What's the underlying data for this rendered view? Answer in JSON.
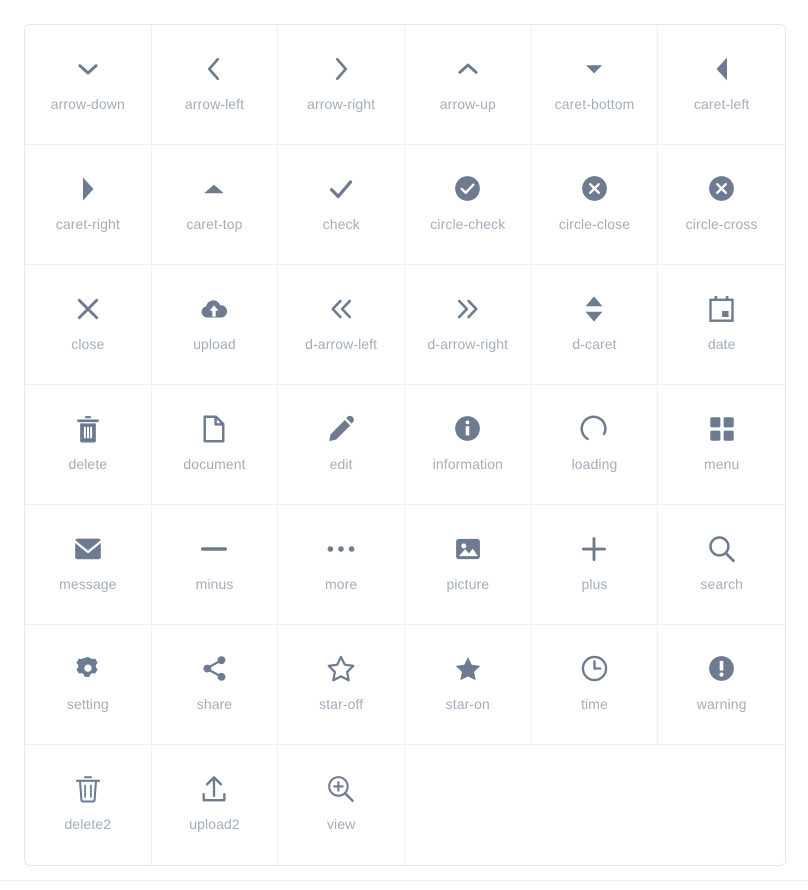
{
  "gallery": {
    "columns": 6,
    "icon_color": "#6c7b8f",
    "label_color": "#a3adbe",
    "grid_line_color": "#eef0f5",
    "border_color": "#e4e7f0",
    "background": "#ffffff",
    "icons": [
      {
        "name": "arrow-down",
        "label": "arrow-down",
        "glyph": "arrow-down-icon"
      },
      {
        "name": "arrow-left",
        "label": "arrow-left",
        "glyph": "arrow-left-icon"
      },
      {
        "name": "arrow-right",
        "label": "arrow-right",
        "glyph": "arrow-right-icon"
      },
      {
        "name": "arrow-up",
        "label": "arrow-up",
        "glyph": "arrow-up-icon"
      },
      {
        "name": "caret-bottom",
        "label": "caret-bottom",
        "glyph": "caret-bottom-icon"
      },
      {
        "name": "caret-left",
        "label": "caret-left",
        "glyph": "caret-left-icon"
      },
      {
        "name": "caret-right",
        "label": "caret-right",
        "glyph": "caret-right-icon"
      },
      {
        "name": "caret-top",
        "label": "caret-top",
        "glyph": "caret-top-icon"
      },
      {
        "name": "check",
        "label": "check",
        "glyph": "check-icon"
      },
      {
        "name": "circle-check",
        "label": "circle-check",
        "glyph": "circle-check-icon"
      },
      {
        "name": "circle-close",
        "label": "circle-close",
        "glyph": "circle-close-icon"
      },
      {
        "name": "circle-cross",
        "label": "circle-cross",
        "glyph": "circle-cross-icon"
      },
      {
        "name": "close",
        "label": "close",
        "glyph": "close-icon"
      },
      {
        "name": "upload",
        "label": "upload",
        "glyph": "cloud-upload-icon"
      },
      {
        "name": "d-arrow-left",
        "label": "d-arrow-left",
        "glyph": "double-arrow-left-icon"
      },
      {
        "name": "d-arrow-right",
        "label": "d-arrow-right",
        "glyph": "double-arrow-right-icon"
      },
      {
        "name": "d-caret",
        "label": "d-caret",
        "glyph": "double-caret-icon"
      },
      {
        "name": "date",
        "label": "date",
        "glyph": "calendar-icon"
      },
      {
        "name": "delete",
        "label": "delete",
        "glyph": "trash-icon"
      },
      {
        "name": "document",
        "label": "document",
        "glyph": "document-icon"
      },
      {
        "name": "edit",
        "label": "edit",
        "glyph": "pencil-icon"
      },
      {
        "name": "information",
        "label": "information",
        "glyph": "info-circle-icon"
      },
      {
        "name": "loading",
        "label": "loading",
        "glyph": "spinner-icon"
      },
      {
        "name": "menu",
        "label": "menu",
        "glyph": "grid-menu-icon"
      },
      {
        "name": "message",
        "label": "message",
        "glyph": "envelope-icon"
      },
      {
        "name": "minus",
        "label": "minus",
        "glyph": "minus-icon"
      },
      {
        "name": "more",
        "label": "more",
        "glyph": "ellipsis-icon"
      },
      {
        "name": "picture",
        "label": "picture",
        "glyph": "image-icon"
      },
      {
        "name": "plus",
        "label": "plus",
        "glyph": "plus-icon"
      },
      {
        "name": "search",
        "label": "search",
        "glyph": "magnifier-icon"
      },
      {
        "name": "setting",
        "label": "setting",
        "glyph": "gear-icon"
      },
      {
        "name": "share",
        "label": "share",
        "glyph": "share-nodes-icon"
      },
      {
        "name": "star-off",
        "label": "star-off",
        "glyph": "star-outline-icon"
      },
      {
        "name": "star-on",
        "label": "star-on",
        "glyph": "star-filled-icon"
      },
      {
        "name": "time",
        "label": "time",
        "glyph": "clock-icon"
      },
      {
        "name": "warning",
        "label": "warning",
        "glyph": "exclamation-circle-icon"
      },
      {
        "name": "delete2",
        "label": "delete2",
        "glyph": "trash-outline-icon"
      },
      {
        "name": "upload2",
        "label": "upload2",
        "glyph": "upload-tray-icon"
      },
      {
        "name": "view",
        "label": "view",
        "glyph": "magnifier-plus-icon"
      }
    ]
  }
}
